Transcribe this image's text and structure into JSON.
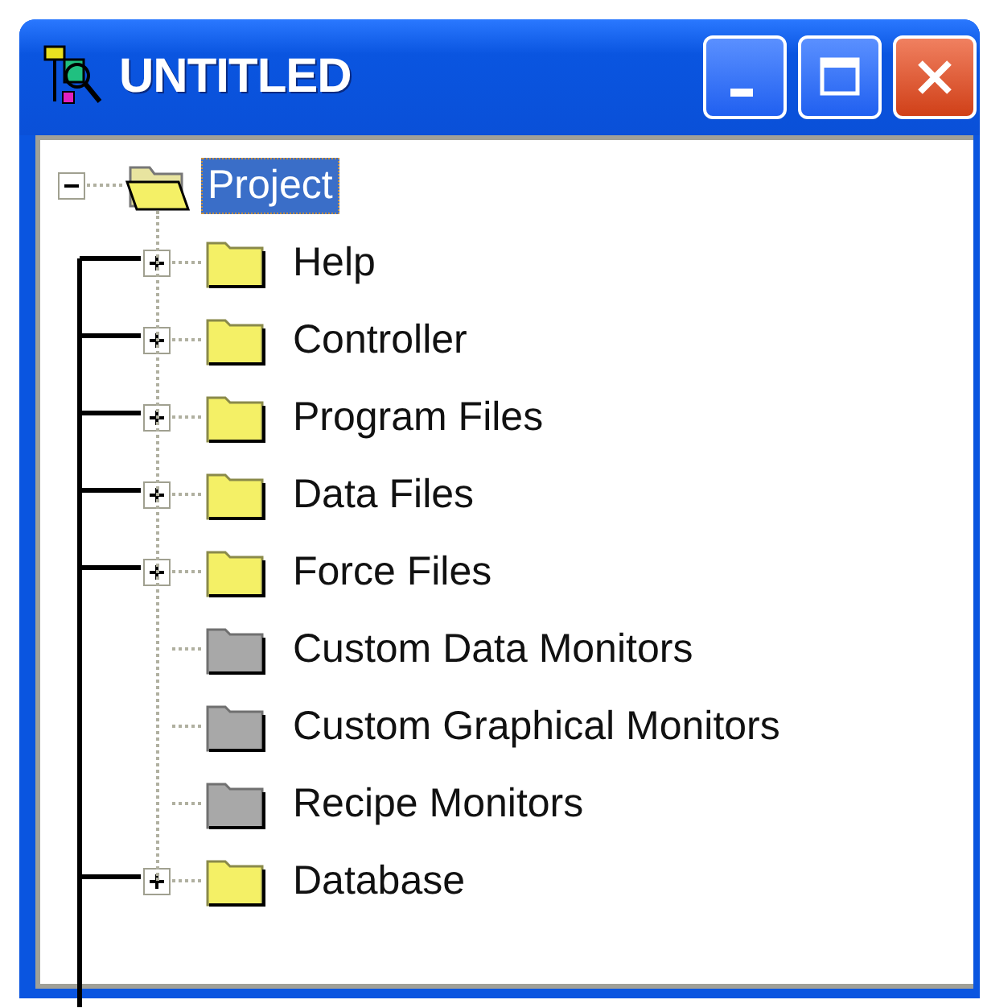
{
  "window": {
    "title": "UNTITLED"
  },
  "tree": {
    "label": "Project",
    "selected": true,
    "expanded": true,
    "children": [
      {
        "label": "Help",
        "kind": "folder",
        "expanded": false,
        "selected": false
      },
      {
        "label": "Controller",
        "kind": "folder",
        "expanded": false,
        "selected": false
      },
      {
        "label": "Program Files",
        "kind": "folder",
        "expanded": false,
        "selected": false
      },
      {
        "label": "Data Files",
        "kind": "folder",
        "expanded": false,
        "selected": false
      },
      {
        "label": "Force Files",
        "kind": "folder",
        "expanded": false,
        "selected": false
      },
      {
        "label": "Custom Data Monitors",
        "kind": "empty",
        "selected": false
      },
      {
        "label": "Custom Graphical Monitors",
        "kind": "empty",
        "selected": false
      },
      {
        "label": "Recipe Monitors",
        "kind": "empty",
        "selected": false
      },
      {
        "label": "Database",
        "kind": "folder",
        "expanded": false,
        "selected": false
      }
    ]
  }
}
